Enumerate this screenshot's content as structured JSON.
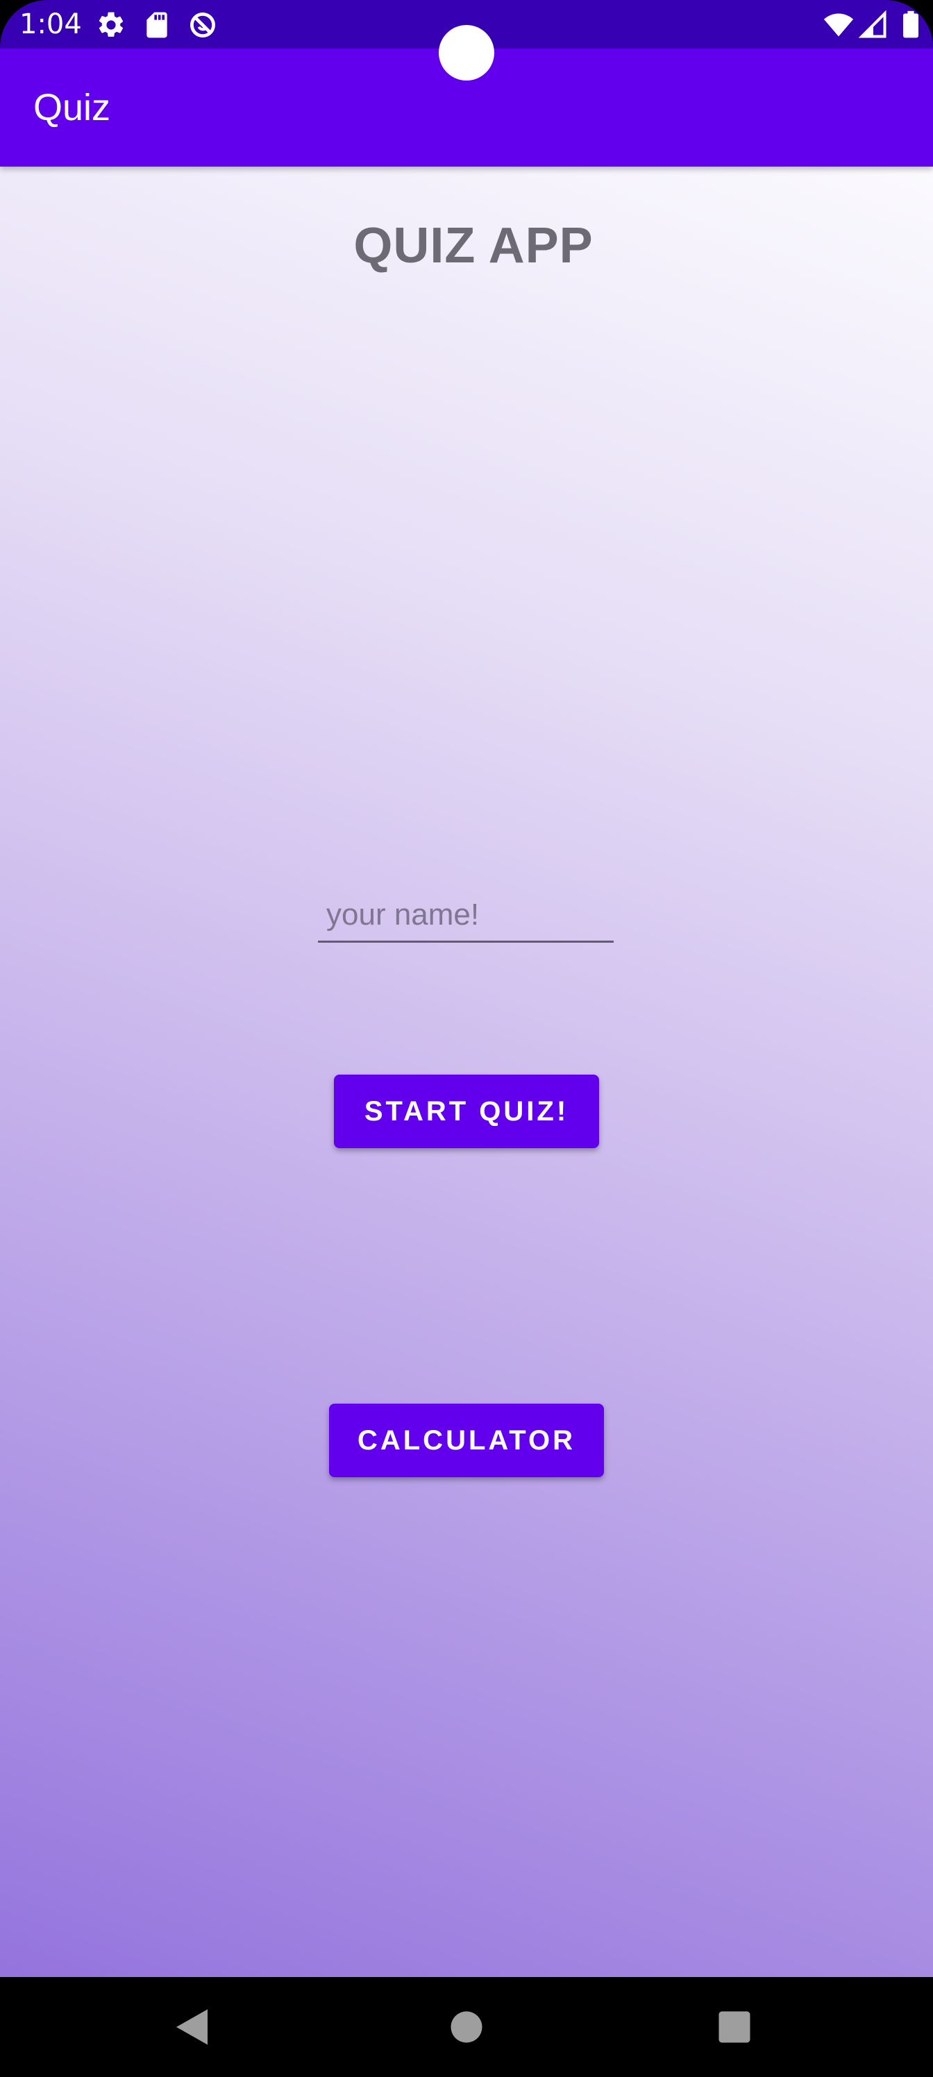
{
  "status_bar": {
    "time": "1:04",
    "icons": [
      "gear-icon",
      "sd-card-icon",
      "do-not-disturb-icon",
      "wifi-icon",
      "signal-icon",
      "battery-icon"
    ]
  },
  "app_bar": {
    "title": "Quiz"
  },
  "main": {
    "heading": "QUIZ APP",
    "name_input": {
      "value": "",
      "placeholder": "your name!"
    },
    "start_button_label": "START QUIZ!",
    "calculator_button_label": "CALCULATOR"
  },
  "nav_bar": {
    "icons": [
      "back-icon",
      "home-icon",
      "recents-icon"
    ]
  },
  "colors": {
    "status_bar": "#3700B3",
    "primary": "#6200EE",
    "heading_text": "#6E6A75",
    "gradient_bottom": "#9474DD",
    "gradient_top": "#FBFAFE"
  }
}
